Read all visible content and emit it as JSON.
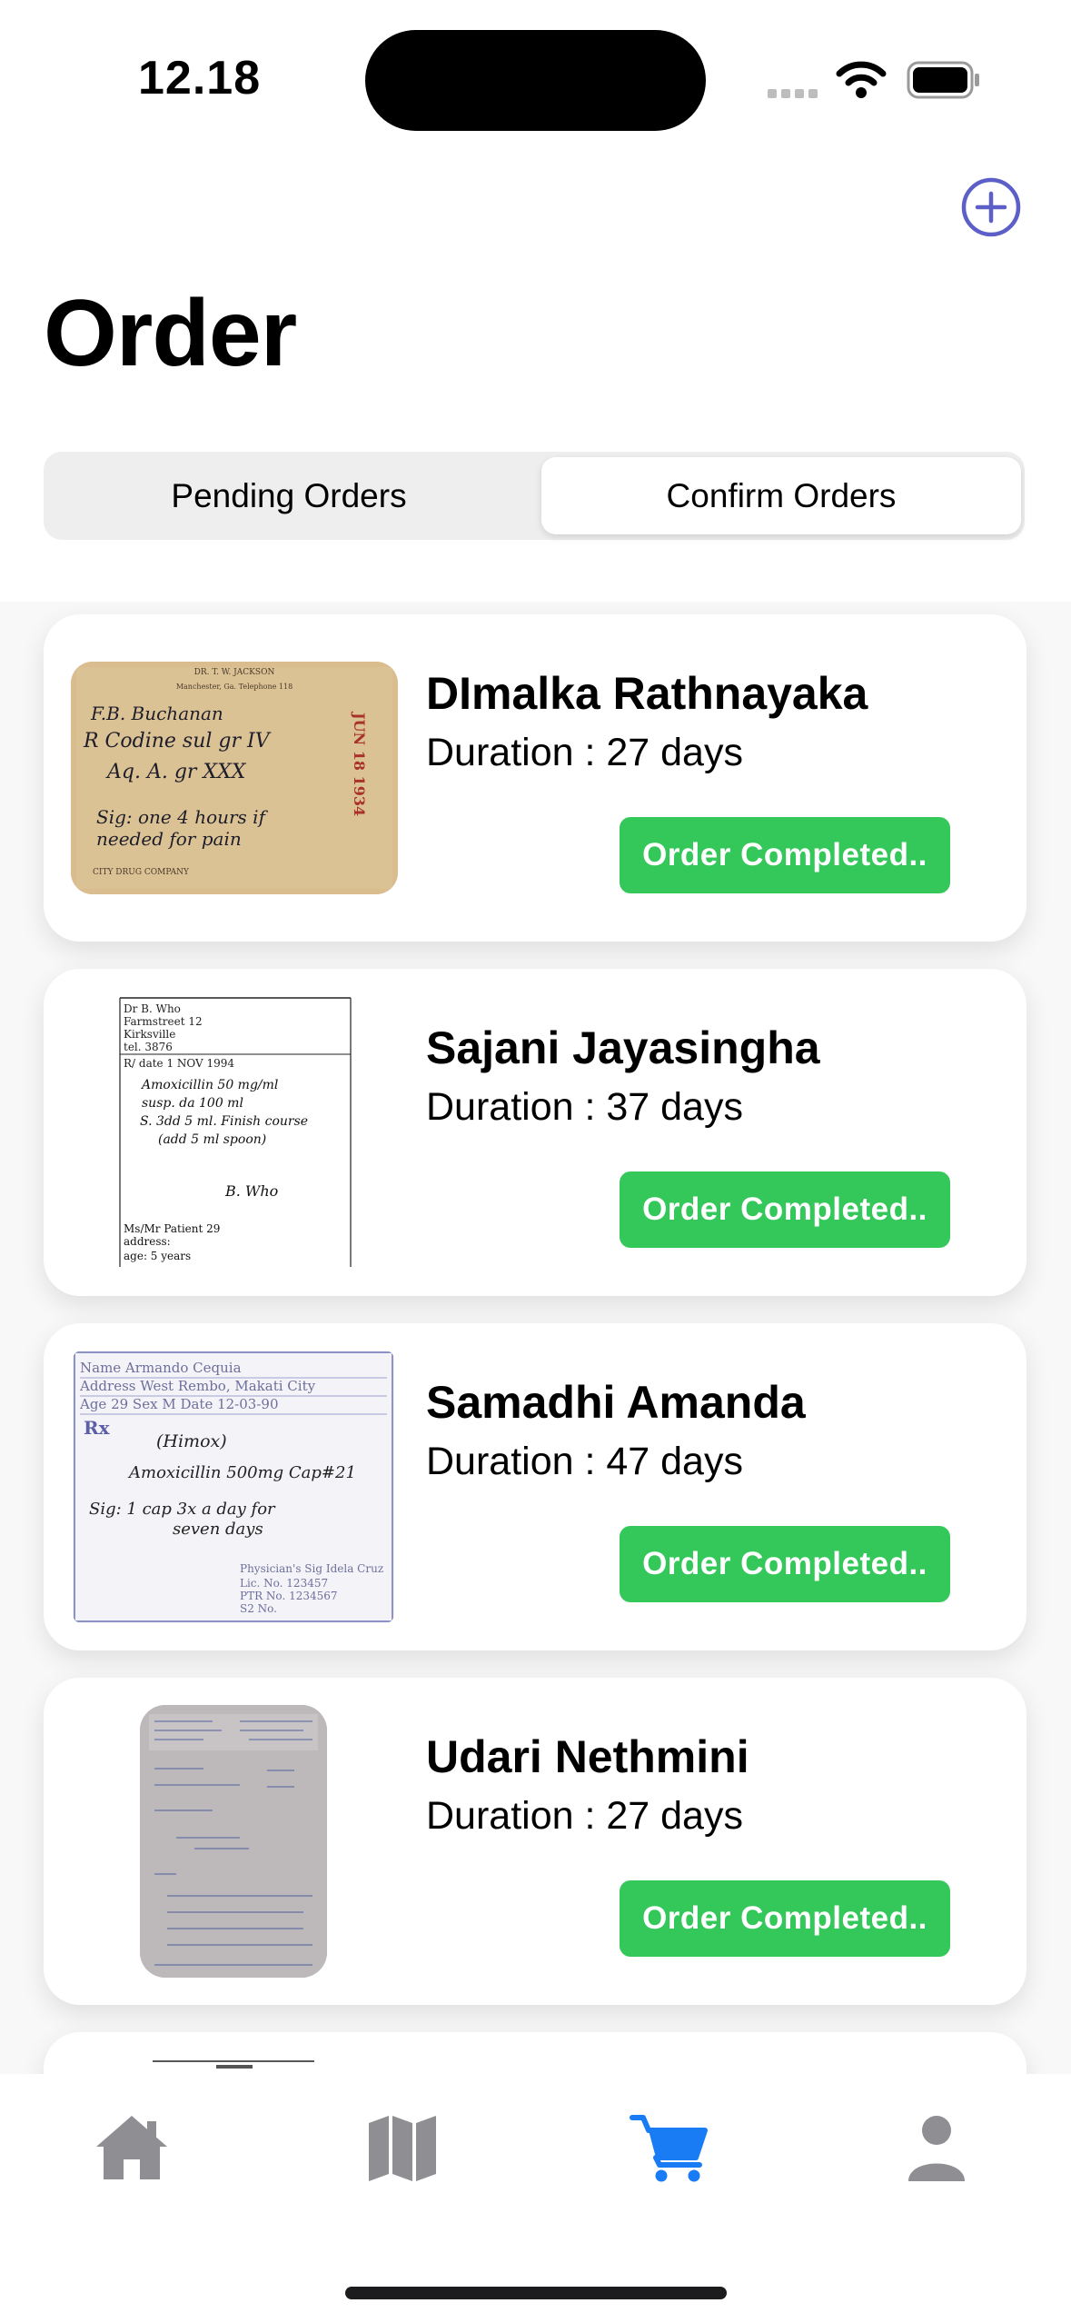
{
  "status_bar": {
    "time": "12.18"
  },
  "header": {
    "title": "Order",
    "add_icon": "plus-circle-icon"
  },
  "segmented": {
    "tabs": [
      "Pending Orders",
      "Confirm Orders"
    ],
    "selected": "Confirm Orders"
  },
  "orders": [
    {
      "name": "DImalka Rathnayaka",
      "duration": "Duration : 27 days",
      "status": "Order Completed..",
      "image": "prescription-image-vintage",
      "rx": {
        "header1": "DR. T. W. JACKSON",
        "header2": "Manchester, Ga.          Telephone 118",
        "patient": "F.B. Buchanan",
        "line1": "R  Codine sul  gr IV",
        "line2": "Aq. A.      gr XXX",
        "line3": "Sig: one 4 hours if",
        "line4": "needed for pain",
        "stamp": "JUN 18 1934",
        "footer": "CITY DRUG COMPANY"
      }
    },
    {
      "name": "Sajani Jayasingha",
      "duration": "Duration : 37 days",
      "status": "Order Completed..",
      "image": "prescription-image-handwritten",
      "rx": {
        "doctor": "Dr B. Who",
        "street": "Farmstreet 12",
        "city": "Kirksville",
        "tel": "tel. 3876",
        "date": "R/        date 1 NOV 1994",
        "line1": "Amoxicillin 50 mg/ml",
        "line2": "susp. da 100 ml",
        "line3": "S. 3dd 5 ml. Finish course",
        "line4": "(add 5 ml spoon)",
        "sig": "B. Who",
        "patient": "Ms/Mr  Patient 29",
        "address": "address:",
        "age": "age:  5 years"
      }
    },
    {
      "name": "Samadhi Amanda",
      "duration": "Duration : 47 days",
      "status": "Order Completed..",
      "image": "prescription-image-form",
      "rx": {
        "name": "Name  Armando Cequia",
        "address": "Address  West Rembo, Makati City",
        "agesex": "Age 29   Sex M   Date 12-03-90",
        "rx": "Rx",
        "brand": "(Himox)",
        "line1": "Amoxicillin 500mg Cap#21",
        "line2": "Sig: 1 cap 3x a day for",
        "line3": "seven days",
        "sig": "Physician's Sig  Idela Cruz",
        "lic": "Lic. No. 123457",
        "ptr": "PTR No. 1234567",
        "s2": "S2 No."
      }
    },
    {
      "name": "Udari Nethmini",
      "duration": "Duration : 27 days",
      "status": "Order Completed..",
      "image": "prescription-image-hospital"
    },
    {
      "name": "",
      "duration": "",
      "status": "",
      "image": "prescription-image-partial"
    }
  ],
  "tabbar": {
    "items": [
      "home-icon",
      "map-icon",
      "cart-icon",
      "person-icon"
    ],
    "active": "cart-icon"
  },
  "colors": {
    "accent": "#5b5fc7",
    "success": "#34c759",
    "tab_active": "#1a7cf5",
    "tab_inactive": "#8e8e93"
  }
}
